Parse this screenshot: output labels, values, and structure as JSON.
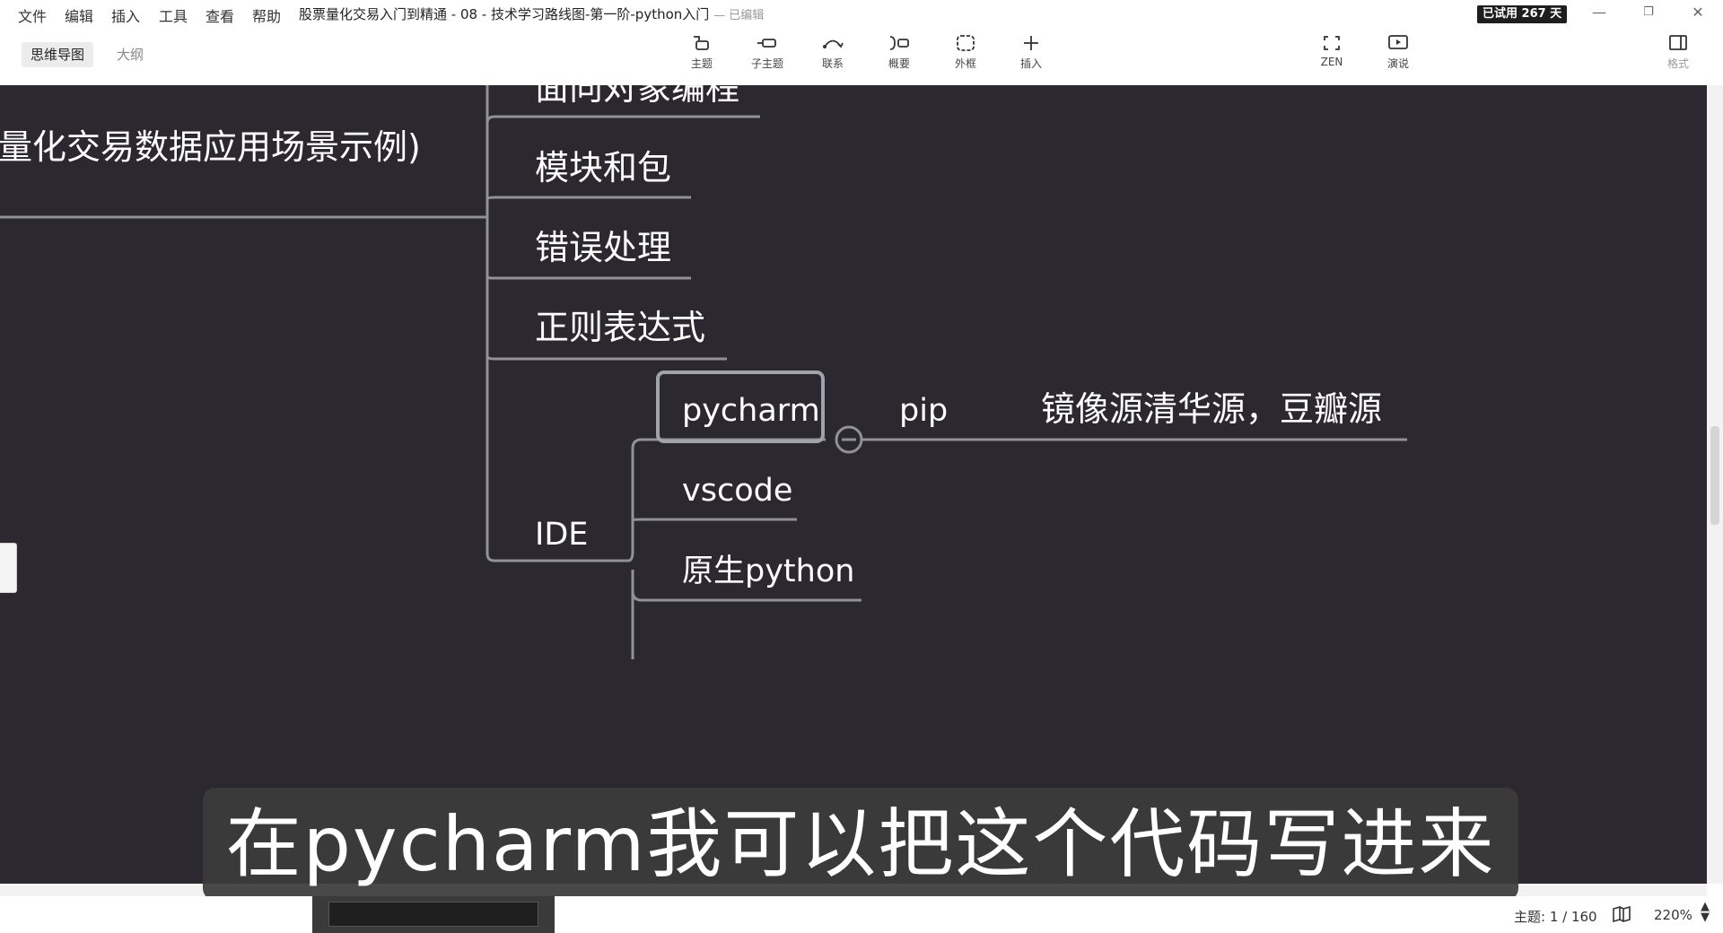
{
  "menu": [
    "文件",
    "编辑",
    "插入",
    "工具",
    "查看",
    "帮助"
  ],
  "document_title": "股票量化交易入门到精通 - 08 - 技术学习路线图-第一阶-python入门",
  "edit_status": "— 已编辑",
  "trial_badge": "已试用 267 天",
  "view_tabs": {
    "mindmap": "思维导图",
    "outline": "大纲"
  },
  "toolbar": {
    "topic": "主题",
    "subtopic": "子主题",
    "relationship": "联系",
    "summary": "概要",
    "boundary": "外框",
    "insert": "插入",
    "zen": "ZEN",
    "present": "演说",
    "format": "格式"
  },
  "mindmap": {
    "parent_fragment": "量化交易数据应用场景示例)",
    "branches": [
      "面向对象编程",
      "模块和包",
      "错误处理",
      "正则表达式",
      "IDE"
    ],
    "ide_children": [
      "pycharm",
      "vscode",
      "原生python"
    ],
    "pycharm_child": "pip",
    "pip_child": "镜像源清华源，豆瓣源"
  },
  "subtitle": "在pycharm我可以把这个代码写进来",
  "status": {
    "topic_count": "主题: 1 / 160",
    "zoom": "220%"
  },
  "colors": {
    "canvas_bg": "#2c2830",
    "branch_line": "#8f9296",
    "selection": "#9ea4aa",
    "node_text": "#ffffff"
  }
}
